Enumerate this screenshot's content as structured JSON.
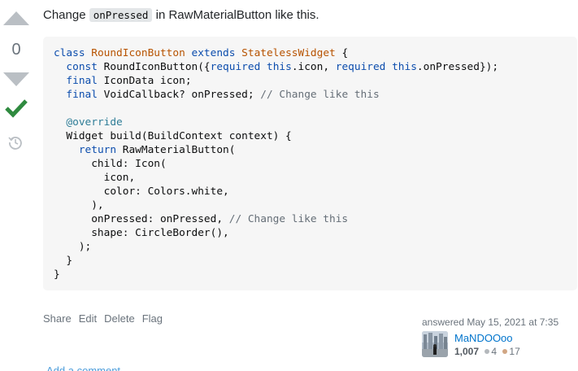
{
  "vote": {
    "count": "0",
    "upvote_icon": "arrow-up-icon",
    "downvote_icon": "arrow-down-icon",
    "accepted_icon": "checkmark-icon",
    "history_icon": "history-icon"
  },
  "post": {
    "intro_before": "Change ",
    "intro_code": "onPressed",
    "intro_after": " in RawMaterialButton like this.",
    "code_lines": [
      [
        [
          "kw",
          "class "
        ],
        [
          "ty",
          "RoundIconButton "
        ],
        [
          "kw",
          "extends "
        ],
        [
          "ty",
          "StatelessWidget"
        ],
        [
          "pl",
          " {"
        ]
      ],
      [
        [
          "pl",
          "  "
        ],
        [
          "kw",
          "const "
        ],
        [
          "pl",
          "RoundIconButton({"
        ],
        [
          "kw",
          "required "
        ],
        [
          "kw",
          "this"
        ],
        [
          "pl",
          ".icon, "
        ],
        [
          "kw",
          "required "
        ],
        [
          "kw",
          "this"
        ],
        [
          "pl",
          ".onPressed});"
        ]
      ],
      [
        [
          "pl",
          "  "
        ],
        [
          "kw",
          "final "
        ],
        [
          "pl",
          "IconData icon;"
        ]
      ],
      [
        [
          "pl",
          "  "
        ],
        [
          "kw",
          "final "
        ],
        [
          "pl",
          "VoidCallback? onPressed; "
        ],
        [
          "cm",
          "// Change like this"
        ]
      ],
      [
        [
          "pl",
          ""
        ]
      ],
      [
        [
          "pl",
          "  "
        ],
        [
          "an",
          "@override"
        ]
      ],
      [
        [
          "pl",
          "  Widget build(BuildContext context) {"
        ]
      ],
      [
        [
          "pl",
          "    "
        ],
        [
          "kw",
          "return "
        ],
        [
          "pl",
          "RawMaterialButton("
        ]
      ],
      [
        [
          "pl",
          "      child: Icon("
        ]
      ],
      [
        [
          "pl",
          "        icon,"
        ]
      ],
      [
        [
          "pl",
          "        color: Colors.white,"
        ]
      ],
      [
        [
          "pl",
          "      ),"
        ]
      ],
      [
        [
          "pl",
          "      onPressed: onPressed, "
        ],
        [
          "cm",
          "// Change like this"
        ]
      ],
      [
        [
          "pl",
          "      shape: CircleBorder(),"
        ]
      ],
      [
        [
          "pl",
          "    );"
        ]
      ],
      [
        [
          "pl",
          "  }"
        ]
      ],
      [
        [
          "pl",
          "}"
        ]
      ]
    ]
  },
  "menu": {
    "share": "Share",
    "edit": "Edit",
    "delete": "Delete",
    "flag": "Flag"
  },
  "user": {
    "action_time": "answered May 15, 2021 at 7:35",
    "name": "MaNDOOoo",
    "reputation": "1,007",
    "silver_badges": "4",
    "bronze_badges": "17",
    "silver_color": "#b4b8bc",
    "bronze_color": "#d1a684"
  },
  "comments": {
    "add_label": "Add a comment"
  }
}
